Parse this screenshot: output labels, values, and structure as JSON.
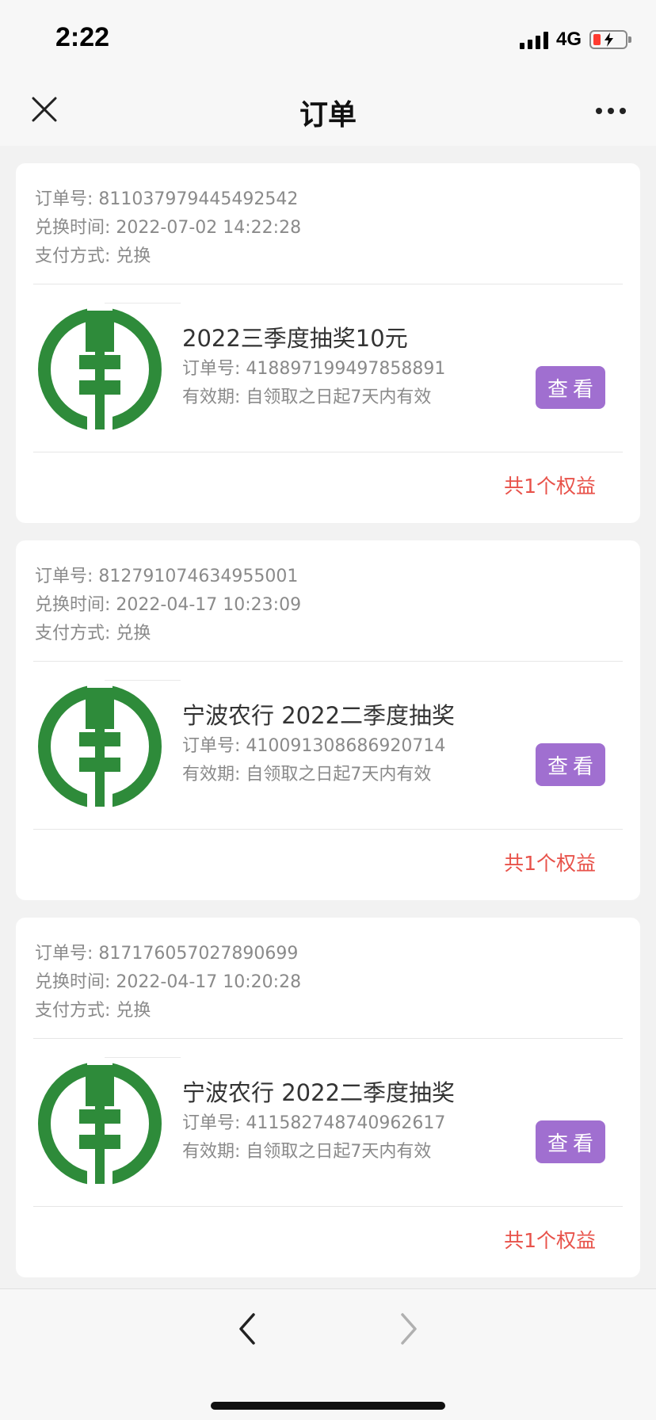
{
  "status_bar": {
    "time": "2:22",
    "network": "4G"
  },
  "nav": {
    "title": "订单",
    "close_icon": "close-icon",
    "more_icon": "more-icon"
  },
  "orders": [
    {
      "order_no_label": "订单号:",
      "order_no": "811037979445492542",
      "exchange_time_label": "兑换时间:",
      "exchange_time": "2022-07-02 14:22:28",
      "pay_method_label": "支付方式:",
      "pay_method": "兑换",
      "item": {
        "title": "2022三季度抽奖10元",
        "sub_order_label": "订单号:",
        "sub_order_no": "418897199497858891",
        "validity_label": "有效期:",
        "validity": "自领取之日起7天内有效"
      },
      "view_button": "查看",
      "summary": "共1个权益"
    },
    {
      "order_no_label": "订单号:",
      "order_no": "812791074634955001",
      "exchange_time_label": "兑换时间:",
      "exchange_time": "2022-04-17 10:23:09",
      "pay_method_label": "支付方式:",
      "pay_method": "兑换",
      "item": {
        "title": "宁波农行 2022二季度抽奖",
        "sub_order_label": "订单号:",
        "sub_order_no": "410091308686920714",
        "validity_label": "有效期:",
        "validity": "自领取之日起7天内有效"
      },
      "view_button": "查看",
      "summary": "共1个权益"
    },
    {
      "order_no_label": "订单号:",
      "order_no": "817176057027890699",
      "exchange_time_label": "兑换时间:",
      "exchange_time": "2022-04-17 10:20:28",
      "pay_method_label": "支付方式:",
      "pay_method": "兑换",
      "item": {
        "title": "宁波农行 2022二季度抽奖",
        "sub_order_label": "订单号:",
        "sub_order_no": "411582748740962617",
        "validity_label": "有效期:",
        "validity": "自领取之日起7天内有效"
      },
      "view_button": "查看",
      "summary": "共1个权益"
    }
  ],
  "bottom_nav": {
    "back_icon": "chevron-left-icon",
    "forward_icon": "chevron-right-icon"
  },
  "colors": {
    "accent_button": "#a06fd0",
    "summary_text": "#e8524a",
    "logo_green": "#2e8b3a",
    "battery_low": "#ff3b30"
  }
}
